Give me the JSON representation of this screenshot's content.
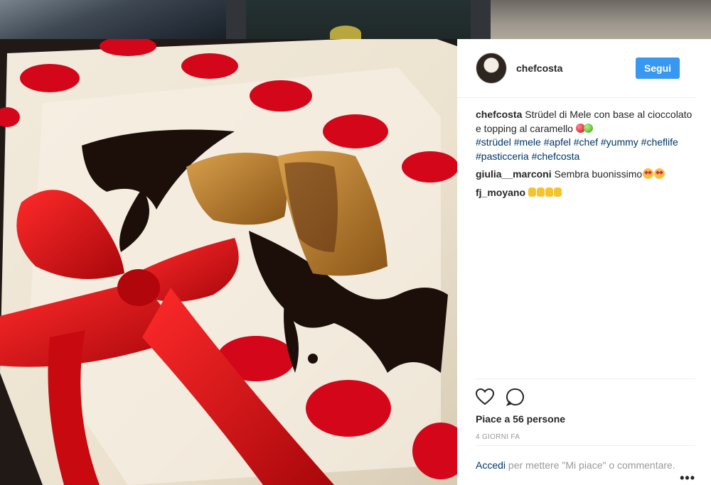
{
  "post": {
    "username": "chefcosta",
    "follow_label": "Segui"
  },
  "caption": {
    "author": "chefcosta",
    "text": "Strüdel di Mele con base al cioccolato e topping al caramello",
    "hashtags": "#strüdel #mele #apfel #chef #yummy #cheflife #pasticceria #chefcosta"
  },
  "comments": [
    {
      "author": "giulia__marconi",
      "text": "Sembra buonissimo"
    },
    {
      "author": "fj_moyano",
      "text": ""
    }
  ],
  "stats": {
    "likes": "Piace a 56 persone",
    "time": "4 giorni fa"
  },
  "login": {
    "link": "Accedi",
    "rest": " per mettere \"Mi piace\" o commentare."
  },
  "icons": [
    "heart-icon",
    "comment-icon",
    "more-options-icon"
  ],
  "colors": {
    "accent": "#3897f0",
    "hashtag": "#003569",
    "ribbon": "#d10f14"
  }
}
